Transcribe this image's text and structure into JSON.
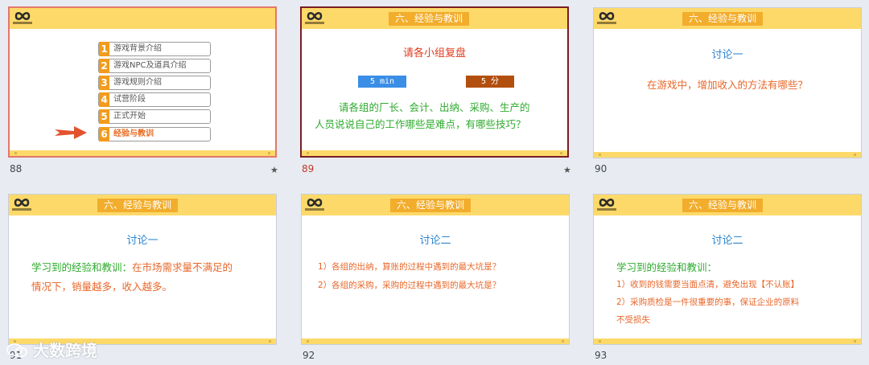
{
  "colors": {
    "header": "#fdd96a",
    "title_tag": "#f2ad2c",
    "orange_text": "#e8672a",
    "green_text": "#2eaa2e",
    "blue_text": "#2e86d1",
    "red_text": "#e03a1e",
    "timer_blue": "#3a8ee6",
    "timer_brown": "#b34f0e"
  },
  "slides": [
    {
      "number": "88",
      "has_star": true,
      "star": "★",
      "agenda": [
        {
          "n": "1",
          "label": "游戏背景介绍"
        },
        {
          "n": "2",
          "label": "游戏NPC及道具介绍"
        },
        {
          "n": "3",
          "label": "游戏规则介绍"
        },
        {
          "n": "4",
          "label": "试营阶段"
        },
        {
          "n": "5",
          "label": "正式开始"
        },
        {
          "n": "6",
          "label": "经验与教训"
        }
      ],
      "current_item": 6
    },
    {
      "number": "89",
      "has_star": true,
      "star": "★",
      "header_title": "六、经验与教训",
      "heading": "请各小组复盘",
      "timer_left": "5 min",
      "timer_right": "5 分",
      "body_line1": "请各组的厂长、会计、出纳、采购、生产的",
      "body_line2": "人员说说自己的工作哪些是难点，有哪些技巧？"
    },
    {
      "number": "90",
      "header_title": "六、经验与教训",
      "heading": "讨论一",
      "body": "在游戏中，增加收入的方法有哪些？"
    },
    {
      "number": "91",
      "header_title": "六、经验与教训",
      "heading": "讨论一",
      "body_green": "学习到的经验和教训：",
      "body_orange1": "在市场需求量不满足的",
      "body_orange2": "情况下，销量越多，收入越多。"
    },
    {
      "number": "92",
      "header_title": "六、经验与教训",
      "heading": "讨论二",
      "line1": "1）各组的出纳，算账的过程中遇到的最大坑是？",
      "line2": "2）各组的采购，采购的过程中遇到的最大坑是？"
    },
    {
      "number": "93",
      "header_title": "六、经验与教训",
      "heading": "讨论二",
      "body_green": "学习到的经验和教训：",
      "line1": "1）收到的钱需要当面点清，避免出现【不认账】",
      "line2": "2）采购质检是一件很重要的事，保证企业的原料",
      "line3": "不受损失"
    }
  ],
  "watermark": "大数跨境",
  "icons": {
    "logo": "infinity-logo-icon",
    "arrow": "right-arrow-icon",
    "watermark": "wechat-logo-icon"
  }
}
